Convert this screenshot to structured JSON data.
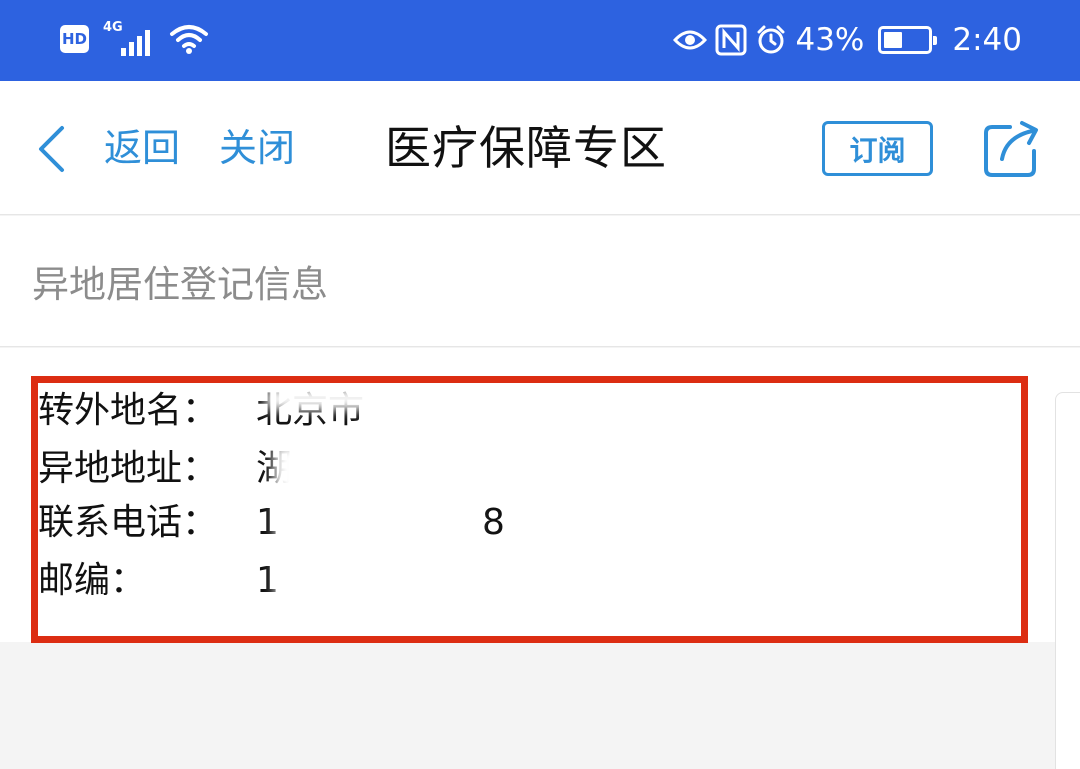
{
  "status_bar": {
    "hd_label": "HD",
    "network_label": "4G",
    "battery_percent": "43%",
    "battery_level": 0.43,
    "time": "2:40"
  },
  "nav": {
    "back_label": "返回",
    "close_label": "关闭",
    "title": "医疗保障专区",
    "subscribe_label": "订阅"
  },
  "section": {
    "title": "异地居住登记信息"
  },
  "info": {
    "rows": [
      {
        "label": "转外地名：",
        "value": "北京市"
      },
      {
        "label": "异地地址：",
        "value": "湖"
      },
      {
        "label": "联系电话：",
        "value": "1",
        "value_end": "8"
      },
      {
        "label": "邮编：",
        "value": "1"
      }
    ]
  },
  "colors": {
    "status_bar": "#2d62e0",
    "accent": "#2f8fd8",
    "highlight_border": "#dc2d12"
  }
}
